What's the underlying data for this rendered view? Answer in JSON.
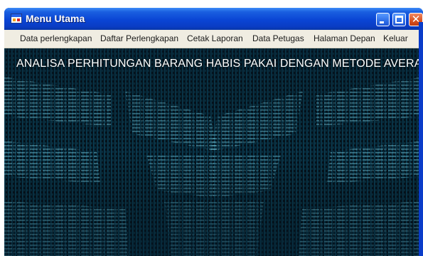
{
  "window": {
    "title": "Menu Utama",
    "accent": "#0a3cc9",
    "titlebar_buttons": [
      "minimize-icon",
      "maximize-icon",
      "close-icon"
    ]
  },
  "menu": {
    "items": [
      {
        "label": "Data perlengkapan"
      },
      {
        "label": "Daftar Perlengkapan"
      },
      {
        "label": "Cetak Laporan"
      },
      {
        "label": "Data Petugas"
      },
      {
        "label": "Halaman Depan"
      },
      {
        "label": "Keluar"
      }
    ]
  },
  "content": {
    "banner": "ANALISA PERHITUNGAN BARANG HABIS PAKAI DENGAN METODE AVERAGE",
    "background_colors": [
      "#04121c",
      "#0f5a78",
      "#1fa8d4",
      "#7fdcf2"
    ]
  }
}
